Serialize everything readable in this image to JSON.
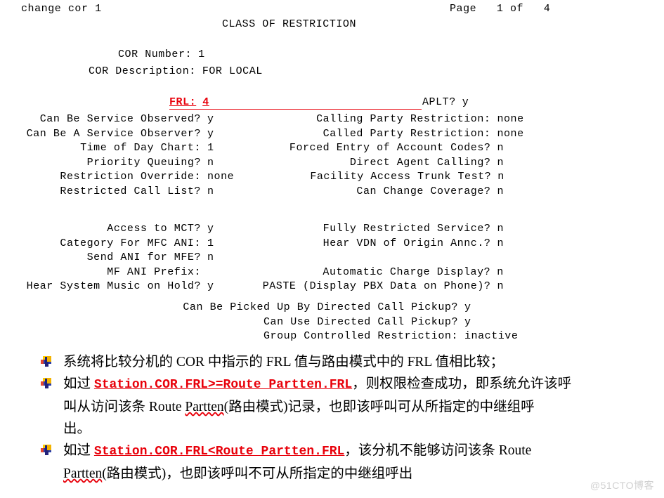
{
  "terminal": {
    "command": "change cor 1",
    "page_indicator": "Page   1 of   4",
    "title": "CLASS OF RESTRICTION",
    "cor_number_label": "COR Number:",
    "cor_number_value": "1",
    "cor_description_label": "COR Description:",
    "cor_description_value": "FOR LOCAL",
    "frl_label": "FRL:",
    "frl_value": "4",
    "aplt_label": "APLT?",
    "aplt_value": "y",
    "block1": [
      {
        "left_label": "Can Be Service Observed?",
        "left_value": "y",
        "right_label": "Calling Party Restriction:",
        "right_value": "none"
      },
      {
        "left_label": "Can Be A Service Observer?",
        "left_value": "y",
        "right_label": "Called Party Restriction:",
        "right_value": "none"
      },
      {
        "left_label": "Time of Day Chart:",
        "left_value": "1",
        "right_label": "Forced Entry of Account Codes?",
        "right_value": "n"
      },
      {
        "left_label": "Priority Queuing?",
        "left_value": "n",
        "right_label": "Direct Agent Calling?",
        "right_value": "n"
      },
      {
        "left_label": "Restriction Override:",
        "left_value": "none",
        "right_label": "Facility Access Trunk Test?",
        "right_value": "n"
      },
      {
        "left_label": "Restricted Call List?",
        "left_value": "n",
        "right_label": "Can Change Coverage?",
        "right_value": "n"
      }
    ],
    "block2": [
      {
        "left_label": "Access to MCT?",
        "left_value": "y",
        "right_label": "Fully Restricted Service?",
        "right_value": "n"
      },
      {
        "left_label": "Category For MFC ANI:",
        "left_value": "1",
        "right_label": "Hear VDN of Origin Annc.?",
        "right_value": "n"
      },
      {
        "left_label": "Send ANI for MFE?",
        "left_value": "n",
        "right_label": "",
        "right_value": ""
      },
      {
        "left_label": "MF ANI Prefix:",
        "left_value": "",
        "right_label": "Automatic Charge Display?",
        "right_value": "n"
      },
      {
        "left_label": "Hear System Music on Hold?",
        "left_value": "y",
        "right_label": "PASTE (Display PBX Data on Phone)?",
        "right_value": "n"
      }
    ],
    "block3": [
      {
        "label": "Can Be Picked Up By Directed Call Pickup?",
        "value": "y"
      },
      {
        "label": "Can Use Directed Call Pickup?",
        "value": "y"
      },
      {
        "label": "Group Controlled Restriction:",
        "value": "inactive"
      }
    ]
  },
  "bullets": [
    {
      "text_a": "系统将比较分机的 ",
      "mono_a": "COR",
      "text_b": " 中指示的 ",
      "mono_b": "FRL",
      "text_c": " 值与路由模式中的 ",
      "mono_c": "FRL",
      "text_d": " 值相比较；"
    },
    {
      "lead": "如过 ",
      "highlight": "Station.COR.FRL>=Route Partten.FRL",
      "after": "，则权限检查成功，即系统允许该呼",
      "line2_a": "叫从访问该条 ",
      "line2_mono": "Route ",
      "line2_sq": "Partten",
      "line2_b": "(路由模式)记录，也即该呼叫可从所指定的中继组呼",
      "line3": "出。"
    },
    {
      "lead": "如过 ",
      "highlight": "Station.COR.FRL<Route Partten.FRL",
      "after": "，该分机不能够访问该条 ",
      "after_mono": "Route",
      "line2_sq": "Partten",
      "line2_b": "(路由模式)，也即该呼叫不可从所指定的中继组呼出"
    }
  ],
  "watermark": "@51CTO博客",
  "colors": {
    "highlight_red": "#e8000a",
    "text_black": "#000000",
    "watermark_gray": "#d0d0d0"
  }
}
